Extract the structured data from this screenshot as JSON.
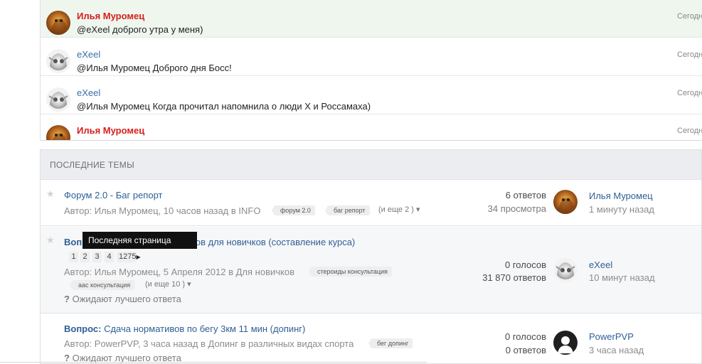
{
  "chat": {
    "messages": [
      {
        "author": "Илья Муромец",
        "text": "@eXeel доброго утра у меня)",
        "time": "Сегодн",
        "highlight": true,
        "avatar": "bear-avatar"
      },
      {
        "author": "eXeel",
        "text": "@Илья Муромец Доброго дня Босс!",
        "time": "Сегодн",
        "highlight": false,
        "avatar": "skull-avatar"
      },
      {
        "author": "eXeel",
        "text": "@Илья Муромец Когда прочитал напомнила о люди Х и Россамаха)",
        "time": "Сегодн",
        "highlight": false,
        "avatar": "skull-avatar"
      },
      {
        "author": "Илья Муромец",
        "text": "",
        "time": "Сегодн",
        "highlight": false,
        "avatar": "bear-avatar"
      }
    ]
  },
  "topics": {
    "header": "ПОСЛЕДНИЕ ТЕМЫ",
    "items": [
      {
        "title": "Форум 2.0 - Баг репорт",
        "meta": "Автор: Илья Муромец, 10 часов назад в INFO",
        "tags": [
          "форум 2.0",
          "баг репорт"
        ],
        "more_tags": "(и еще 2 )",
        "stat1": "6 ответов",
        "stat2": "34 просмотра",
        "last_user": "Илья Муромец",
        "last_time": "1 минуту назад"
      },
      {
        "prefix": "Вопрос:",
        "title": "Вопрос: Учебник по применению стероидов для новичков (составление курса)",
        "title_visible": "применению стероидов для новичков (составление курса)",
        "pages": [
          "1",
          "2",
          "3",
          "4",
          "1275"
        ],
        "meta": "Автор: Илья Муромец, 5 Апреля 2012 в Для новичков",
        "tags": [
          "стероиды консультация",
          "аас консультация"
        ],
        "more_tags": "(и еще 10 )",
        "waiting": "Ожидают лучшего ответа",
        "stat1": "0 голосов",
        "stat2": "31 870 ответов",
        "last_user": "eXeel",
        "last_time": "10 минут назад"
      },
      {
        "prefix": "Вопрос:",
        "title": "Сдача нормативов по бегу 3км 11 мин (допинг)",
        "meta": "Автор: PowerPVP, 3 часа назад в Допинг в различных видах спорта",
        "tags": [
          "бег допинг"
        ],
        "waiting": "Ожидают лучшего ответа",
        "stat1": "0 голосов",
        "stat2": "0 ответов",
        "last_user": "PowerPVP",
        "last_time": "3 часа назад"
      }
    ]
  },
  "tooltip": "Последняя страница",
  "colors": {
    "link": "#2f5f96",
    "author_red": "#d61e1e",
    "header_bg": "#ebedf0",
    "highlight_bg": "#eef6ee"
  }
}
